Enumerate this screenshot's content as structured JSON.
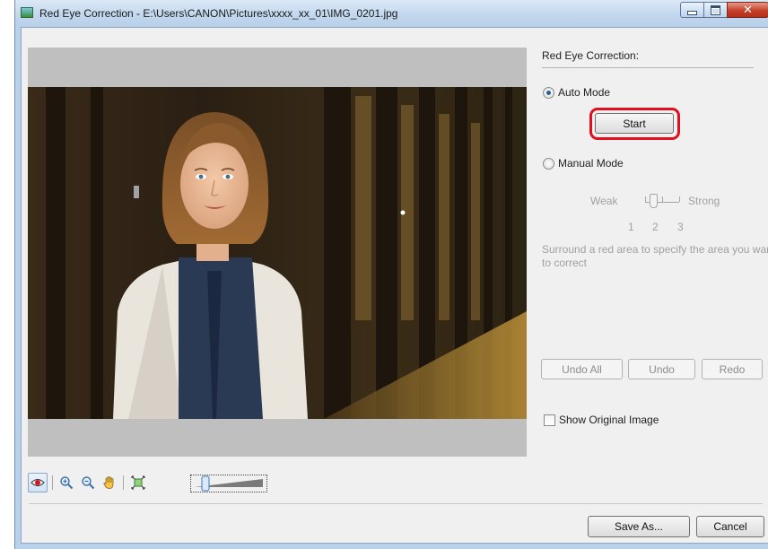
{
  "window": {
    "title": "Red Eye Correction - E:\\Users\\CANON\\Pictures\\xxxx_xx_01\\IMG_0201.jpg",
    "icons": {
      "app": "image-app-icon",
      "minimize": "minimize-icon",
      "maximize": "maximize-icon",
      "close": "close-icon"
    },
    "close_glyph": "✕"
  },
  "panel": {
    "title": "Red Eye Correction:",
    "auto_mode_label": "Auto Mode",
    "auto_mode_selected": true,
    "start_label": "Start",
    "manual_mode_label": "Manual Mode",
    "manual_mode_selected": false,
    "strength": {
      "weak_label": "Weak",
      "strong_label": "Strong",
      "levels": [
        "1",
        "2",
        "3"
      ],
      "value": 2
    },
    "instruction_line1": "Surround a red area to specify the area you want",
    "instruction_line2": "to correct",
    "undo_all_label": "Undo All",
    "undo_label": "Undo",
    "redo_label": "Redo",
    "show_original_label": "Show Original Image",
    "show_original_checked": false
  },
  "toolbar": {
    "tools": [
      "red-eye-tool-icon",
      "zoom-in-icon",
      "zoom-out-icon",
      "hand-pan-icon",
      "fit-to-window-icon"
    ],
    "zoom_level_fraction": 0.12
  },
  "footer": {
    "save_as_label": "Save As...",
    "cancel_label": "Cancel"
  },
  "colors": {
    "highlight_ring": "#e0101e",
    "selected_tool_bg": "#cfe2f6",
    "window_frame": "#b9d1ea"
  }
}
